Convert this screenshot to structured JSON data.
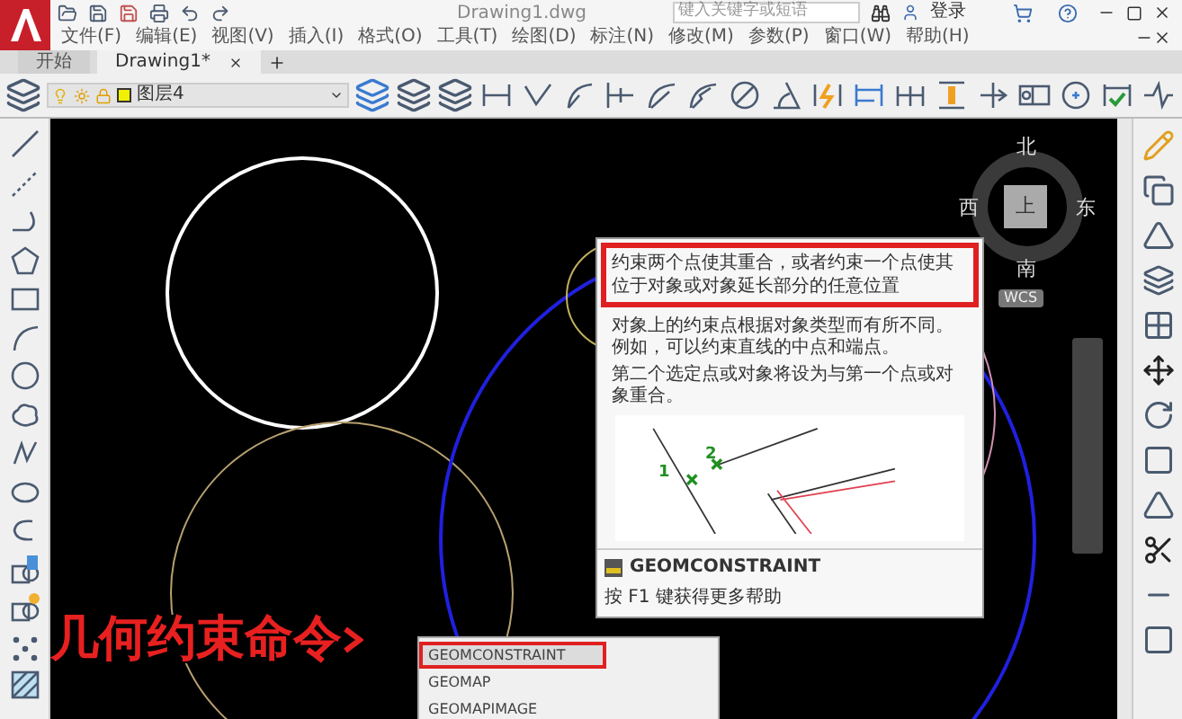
{
  "window": {
    "title": "Drawing1.dwg",
    "search": {
      "placeholder": "键入关键字或短语"
    },
    "sign_in": "登录"
  },
  "menu": [
    "文件(F)",
    "编辑(E)",
    "视图(V)",
    "插入(I)",
    "格式(O)",
    "工具(T)",
    "绘图(D)",
    "标注(N)",
    "修改(M)",
    "参数(P)",
    "窗口(W)",
    "帮助(H)"
  ],
  "tabs": [
    {
      "label": "开始",
      "selected": false
    },
    {
      "label": "Drawing1*",
      "selected": true
    }
  ],
  "layer": {
    "name": "图层4"
  },
  "viewcube": {
    "north": "北",
    "south": "南",
    "east": "东",
    "west": "西",
    "face": "上",
    "ucs": "WCS"
  },
  "tooltip": {
    "summary": "约束两个点使其重合，或者约束一个点使其位于对象或对象延长部分的任意位置",
    "paragraphs": [
      "对象上的约束点根据对象类型而有所不同。例如，可以约束直线的中点和端点。",
      "第二个选定点或对象将设为与第一个点或对象重合。"
    ],
    "diagram_labels": [
      "2",
      "1"
    ],
    "command": "GEOMCONSTRAINT",
    "help": "按 F1 键获得更多帮助"
  },
  "autocomplete": [
    {
      "label": "GEOMCONSTRAINT",
      "selected": true
    },
    {
      "label": "GEOMAP",
      "selected": false
    },
    {
      "label": "GEOMAPIMAGE",
      "selected": false
    }
  ],
  "annotation": "几何约束命令"
}
